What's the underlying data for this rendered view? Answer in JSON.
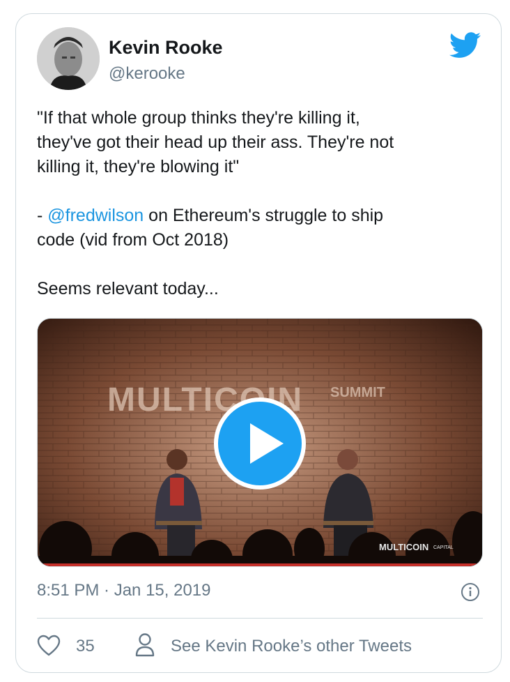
{
  "author": {
    "name": "Kevin Rooke",
    "handle": "@kerooke"
  },
  "tweet": {
    "quote": "\"If that whole group thinks they're killing it,\nthey've got their head up their ass. They're not\nkilling it, they're blowing it\"",
    "attribution_prefix": "- ",
    "mention": "@fredwilson",
    "attribution_rest": " on Ethereum's struggle to ship\ncode (vid from Oct 2018)",
    "closing": "Seems relevant today..."
  },
  "media": {
    "sign_left": "MULTICOIN",
    "sign_right": "SUMMIT",
    "watermark": "MULTICOIN",
    "watermark_small": "CAPITAL"
  },
  "meta": {
    "timestamp": "8:51 PM · Jan 15, 2019"
  },
  "actions": {
    "like_count": "35",
    "other_tweets_label": "See Kevin Rooke’s other Tweets"
  },
  "colors": {
    "accent": "#1da1f2",
    "mention": "#1b95e0",
    "secondary_text": "#657786"
  }
}
